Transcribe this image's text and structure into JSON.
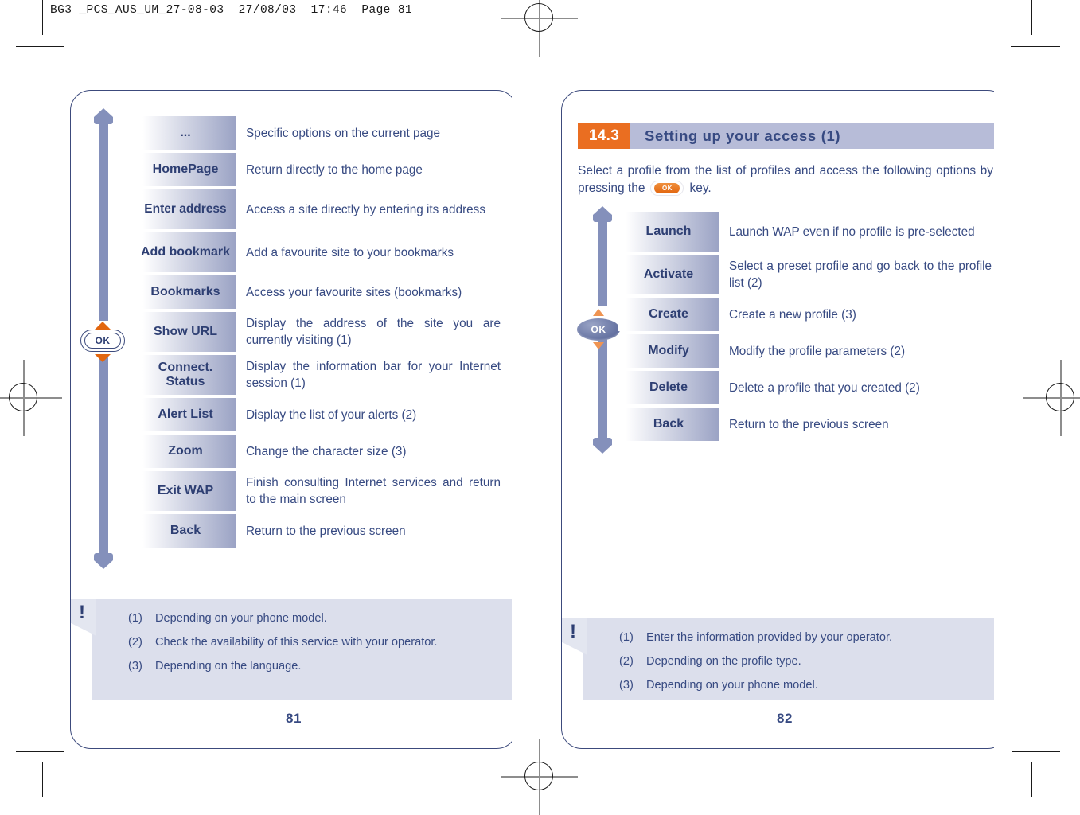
{
  "print_header": "BG3 _PCS_AUS_UM_27-08-03  27/08/03  17:46  Page 81",
  "left_page": {
    "page_number": "81",
    "ok_key_label": "OK",
    "menu_items": [
      {
        "label": "...",
        "desc": "Specific options on the current page"
      },
      {
        "label": "HomePage",
        "desc": "Return directly to the home page"
      },
      {
        "label": "Enter address",
        "desc": "Access a site directly by entering its address"
      },
      {
        "label": "Add bookmark",
        "desc": "Add a favourite site to your bookmarks"
      },
      {
        "label": "Bookmarks",
        "desc": "Access your favourite sites (bookmarks)"
      },
      {
        "label": "Show URL",
        "desc": "Display the address of the site you are currently visiting (1)"
      },
      {
        "label": "Connect. Status",
        "desc": "Display the information bar for your Internet session (1)"
      },
      {
        "label": "Alert List",
        "desc": "Display the list of your alerts (2)"
      },
      {
        "label": "Zoom",
        "desc": "Change the character size (3)"
      },
      {
        "label": "Exit WAP",
        "desc": "Finish consulting Internet services and return to the main screen"
      },
      {
        "label": "Back",
        "desc": "Return to the previous screen"
      }
    ],
    "footnotes": [
      {
        "num": "(1)",
        "text": "Depending on your phone model."
      },
      {
        "num": "(2)",
        "text": "Check the availability of this service with your operator."
      },
      {
        "num": "(3)",
        "text": "Depending on the language."
      }
    ]
  },
  "right_page": {
    "page_number": "82",
    "section_number": "14.3",
    "section_title": "Setting up your access",
    "section_title_suffix": "(1)",
    "intro_part1": "Select a profile from the list of profiles and access the following options by pressing the",
    "intro_part2": "key.",
    "ok_key_label": "OK",
    "inline_ok_label": "OK",
    "menu_items": [
      {
        "label": "Launch",
        "desc": "Launch WAP even if no profile is pre-selected"
      },
      {
        "label": "Activate",
        "desc": "Select a preset profile and go back to the profile list (2)"
      },
      {
        "label": "Create",
        "desc": "Create a new profile (3)"
      },
      {
        "label": "Modify",
        "desc": "Modify the profile parameters (2)"
      },
      {
        "label": "Delete",
        "desc": "Delete a profile that you created (2)"
      },
      {
        "label": "Back",
        "desc": "Return to the previous screen"
      }
    ],
    "footnotes": [
      {
        "num": "(1)",
        "text": "Enter the information provided by your operator."
      },
      {
        "num": "(2)",
        "text": "Depending on the profile type."
      },
      {
        "num": "(3)",
        "text": "Depending on your phone model."
      }
    ]
  },
  "colors": {
    "accent_orange": "#ea6e21",
    "navy": "#374a82",
    "menu_gradient_end": "#9aa2c4",
    "section_bar": "#b7bcd8",
    "footnote_bg": "#dcdfec",
    "arrow": "#8490bb"
  }
}
